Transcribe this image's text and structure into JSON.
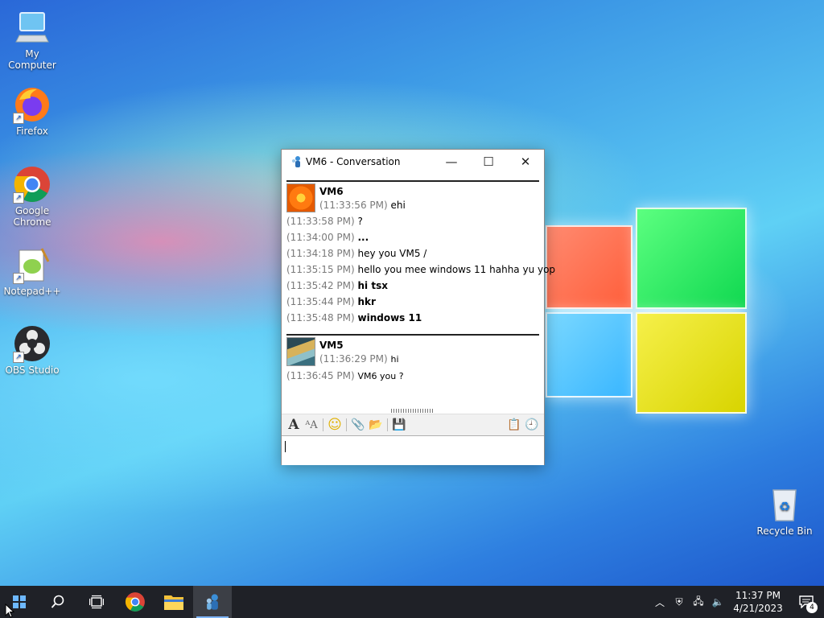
{
  "desktop": {
    "icons": [
      {
        "label": "My Computer"
      },
      {
        "label": "Firefox"
      },
      {
        "label": "Google Chrome"
      },
      {
        "label": "Notepad++"
      },
      {
        "label": "OBS Studio"
      },
      {
        "label": "Recycle Bin"
      }
    ]
  },
  "window": {
    "title": "VM6 - Conversation",
    "controls": {
      "minimize": "—",
      "maximize": "☐",
      "close": "✕"
    },
    "blocks": [
      {
        "sender": "VM6",
        "messages": [
          {
            "time": "(11:33:56 PM)",
            "text": "ehi",
            "style": "normal"
          },
          {
            "time": "(11:33:58 PM)",
            "text": "?",
            "style": "normal"
          },
          {
            "time": "(11:34:00 PM)",
            "text": "...",
            "style": "bold"
          },
          {
            "time": "(11:34:18 PM)",
            "text": "hey you VM5 /",
            "style": "normal"
          },
          {
            "time": "(11:35:15 PM)",
            "text": "hello you mee windows 11  hahha yu yop",
            "style": "normal"
          },
          {
            "time": "(11:35:42 PM)",
            "text": "hi tsx",
            "style": "bold"
          },
          {
            "time": "(11:35:44 PM)",
            "text": "hkr",
            "style": "bold"
          },
          {
            "time": "(11:35:48 PM)",
            "text": "windows 11",
            "style": "bold"
          }
        ]
      },
      {
        "sender": "VM5",
        "messages": [
          {
            "time": "(11:36:29 PM)",
            "text": "hi",
            "style": "small"
          },
          {
            "time": "(11:36:45 PM)",
            "text": "VM6 you ?",
            "style": "small"
          }
        ]
      }
    ],
    "compose": {
      "value": ""
    }
  },
  "taskbar": {
    "tray": {
      "time": "11:37 PM",
      "date": "4/21/2023",
      "notifications": "4"
    }
  },
  "colors": {
    "taskbar": "#1f2127",
    "timestamp": "#7a7a7a"
  }
}
